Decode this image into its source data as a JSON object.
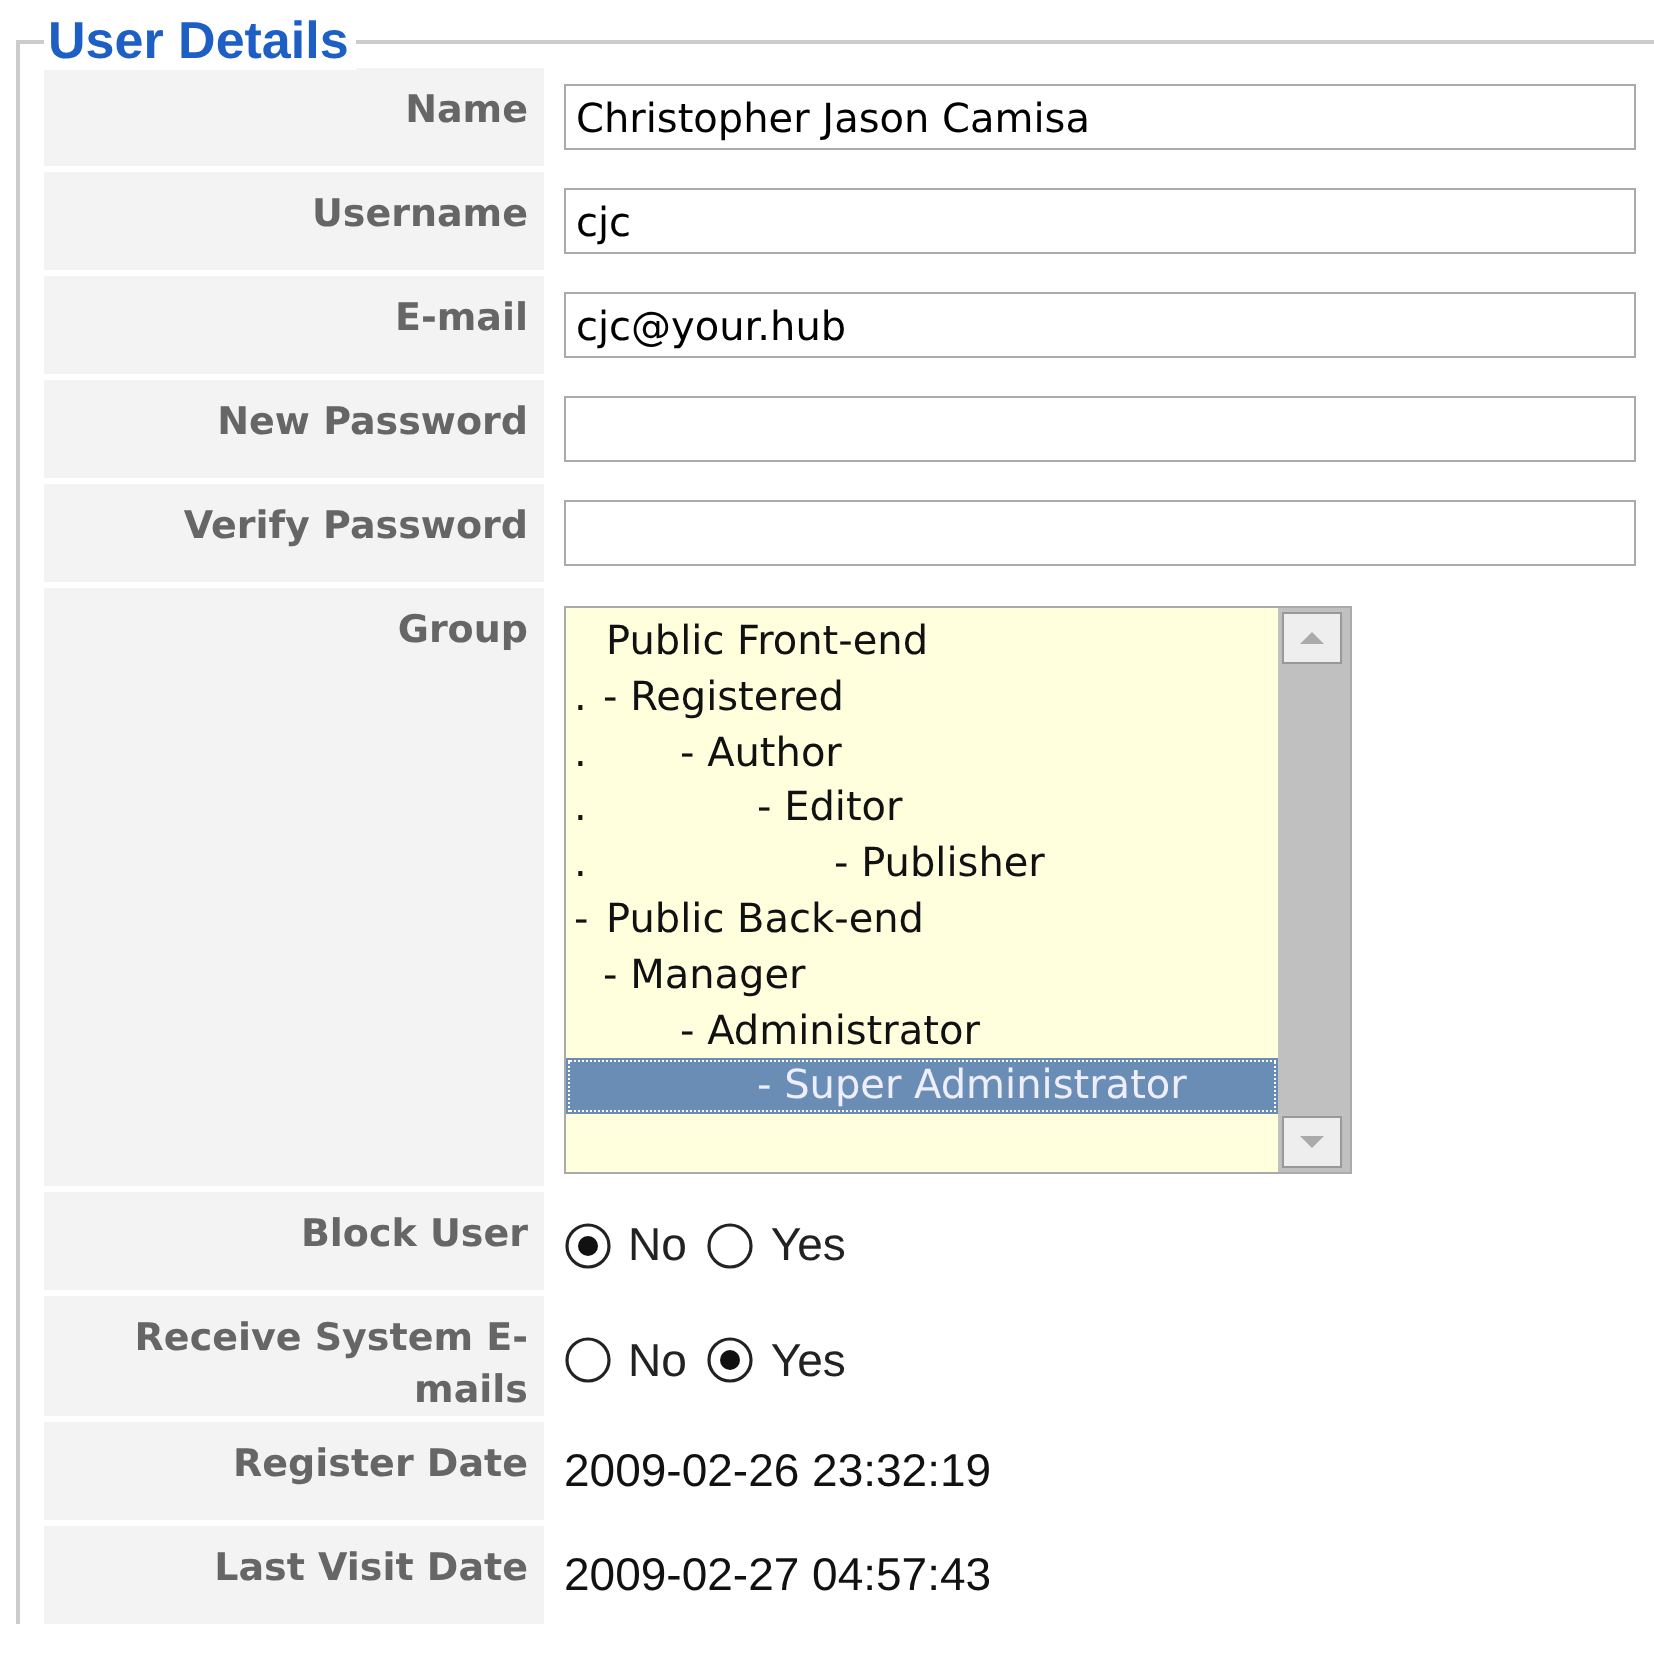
{
  "legend": "User Details",
  "fields": [
    {
      "kind": "text",
      "label": "Name",
      "value": "Christopher Jason Camisa"
    },
    {
      "kind": "text",
      "label": "Username",
      "value": "cjc"
    },
    {
      "kind": "text",
      "label": "E-mail",
      "value": "cjc@your.hub"
    },
    {
      "kind": "password",
      "label": "New Password"
    },
    {
      "kind": "password",
      "label": "Verify Password"
    },
    {
      "kind": "listbox",
      "label": "Group",
      "options": [
        {
          "text": "Public Front-end",
          "selected": false,
          "children": [
            {
              "prefix": ".",
              "text": "- Registered",
              "selected": false,
              "children": [
                {
                  "prefix": ".",
                  "text": "- Author",
                  "selected": false,
                  "children": [
                    {
                      "prefix": ".",
                      "text": "- Editor",
                      "selected": false,
                      "children": [
                        {
                          "prefix": ".",
                          "text": "- Publisher",
                          "selected": false
                        }
                      ]
                    }
                  ]
                }
              ]
            }
          ]
        },
        {
          "prefix": "-",
          "text": "Public Back-end",
          "selected": false,
          "children": [
            {
              "text": "- Manager",
              "selected": false,
              "children": [
                {
                  "text": "- Administrator",
                  "selected": false,
                  "children": [
                    {
                      "text": "- Super Administrator",
                      "selected": true
                    }
                  ]
                }
              ]
            }
          ]
        }
      ]
    },
    {
      "kind": "radio",
      "label": "Block User",
      "options": [
        {
          "label": "No",
          "selected": true
        },
        {
          "label": "Yes",
          "selected": false
        }
      ]
    },
    {
      "kind": "radio",
      "label": "Receive System E-mails",
      "options": [
        {
          "label": "No",
          "selected": false
        },
        {
          "label": "Yes",
          "selected": true
        }
      ]
    },
    {
      "kind": "static",
      "label": "Register Date",
      "value": "2009-02-26 23:32:19"
    },
    {
      "kind": "static",
      "label": "Last Visit Date",
      "value": "2009-02-27 04:57:43"
    }
  ]
}
